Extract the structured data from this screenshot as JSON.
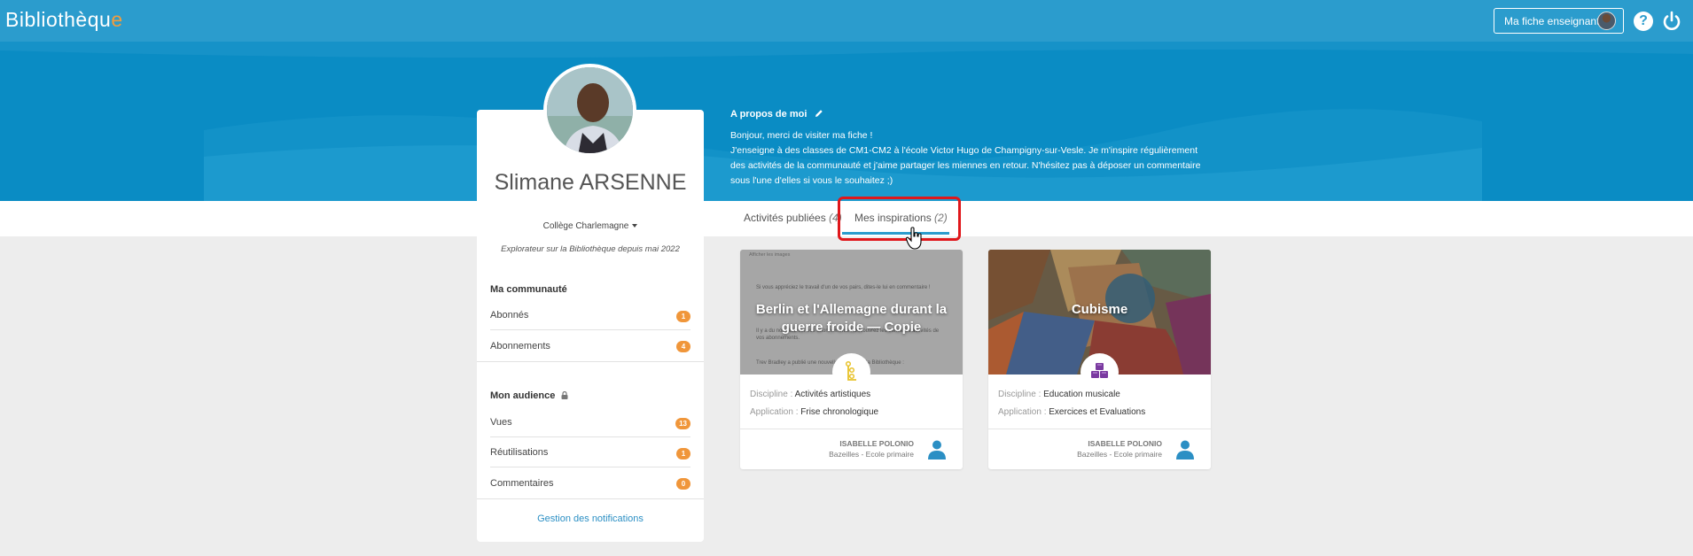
{
  "app": {
    "logo_text": "Bibliothèqu",
    "logo_accent": "e"
  },
  "header": {
    "profile_button_label": "Ma fiche enseignant",
    "help_icon": "question-circle-icon",
    "power_icon": "power-icon"
  },
  "profile": {
    "name": "Slimane ARSENNE",
    "school": "Collège Charlemagne",
    "since": "Explorateur sur la Bibliothèque depuis mai 2022"
  },
  "community": {
    "title": "Ma communauté",
    "items": [
      {
        "label": "Abonnés",
        "count": "1"
      },
      {
        "label": "Abonnements",
        "count": "4"
      }
    ]
  },
  "audience": {
    "title": "Mon audience",
    "items": [
      {
        "label": "Vues",
        "count": "13"
      },
      {
        "label": "Réutilisations",
        "count": "1"
      },
      {
        "label": "Commentaires",
        "count": "0"
      }
    ]
  },
  "notifications_link": "Gestion des notifications",
  "about": {
    "title": "A propos de moi",
    "line1": "Bonjour, merci de visiter ma fiche !",
    "line2": "J'enseigne à des classes de CM1-CM2 à l'école Victor Hugo de Champigny-sur-Vesle. Je m'inspire régulièrement des activités de la communauté et j'aime partager les miennes en retour. N'hésitez pas à déposer un commentaire sous l'une d'elles si vous le souhaitez ;)"
  },
  "tabs": [
    {
      "label": "Activités publiées",
      "count": "(4)"
    },
    {
      "label": "Mes inspirations",
      "count": "(2)"
    }
  ],
  "cards": [
    {
      "title": "Berlin et l'Allemagne durant la guerre froide — Copie",
      "discipline_label": "Discipline :",
      "discipline": "Activités artistiques",
      "application_label": "Application :",
      "application": "Frise chronologique",
      "author": "ISABELLE POLONIO",
      "org": "Bazeilles - Ecole primaire",
      "thumb_lines": [
        "Afficher les images",
        "Si vous appréciez le travail d'un de vos pairs, dites-le lui en commentaire !",
        "Il y a du nouveau sur vos abonnements ! Découvrez les dernières activités de vos abonnements.",
        "Trev Bradley a publié une nouvelle activité sur la Bibliothèque :"
      ]
    },
    {
      "title": "Cubisme",
      "discipline_label": "Discipline :",
      "discipline": "Education musicale",
      "application_label": "Application :",
      "application": "Exercices et Evaluations",
      "author": "ISABELLE POLONIO",
      "org": "Bazeilles - Ecole primaire"
    }
  ],
  "colors": {
    "topbar": "#2b9ccd",
    "banner": "#0a8cc4",
    "badge": "#f0963a",
    "highlight": "#e0171b"
  }
}
